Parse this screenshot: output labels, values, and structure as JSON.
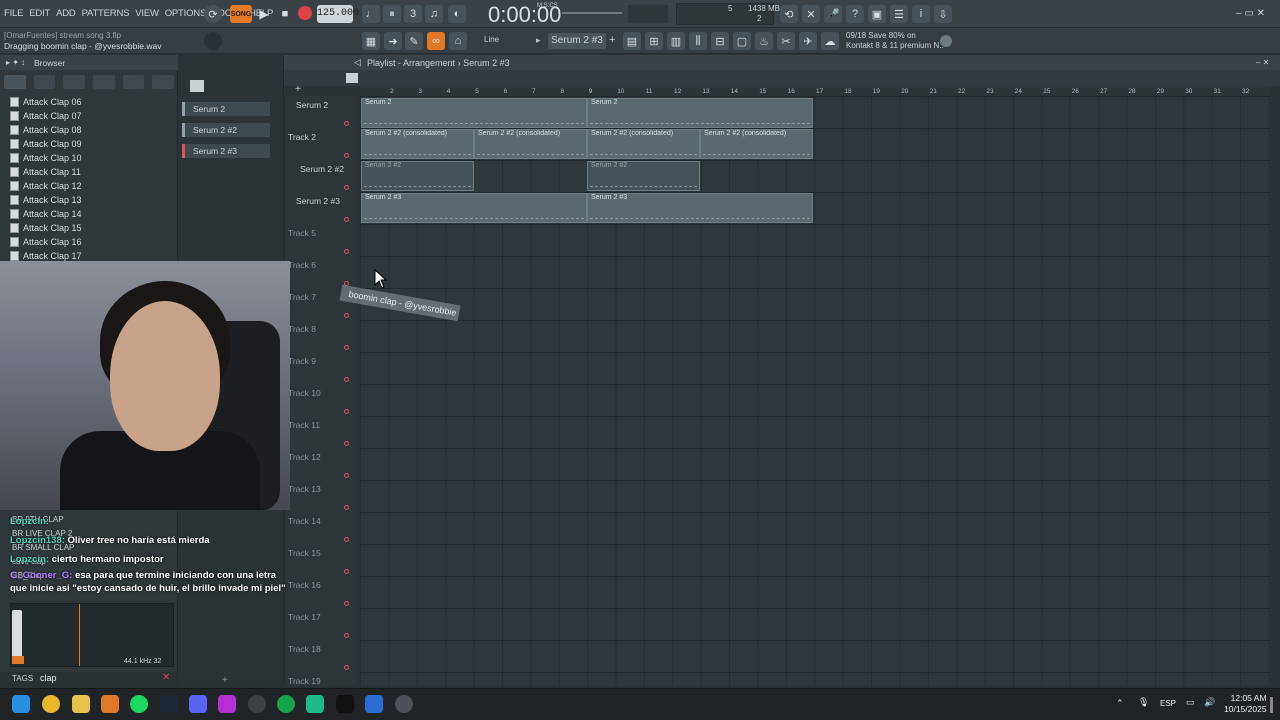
{
  "menu": [
    "FILE",
    "EDIT",
    "ADD",
    "PATTERNS",
    "VIEW",
    "OPTIONS",
    "TOOLS",
    "HELP"
  ],
  "transport": {
    "song_label": "SONG",
    "tempo": "125.000",
    "time": "0:00:00",
    "time_unit": "M:S:CS",
    "memory": "1438 MB",
    "voices": "5",
    "cpu": "2"
  },
  "status": {
    "file_info": "[OmarFuentes] stream song 3.flp",
    "hint": "Dragging boomin clap - @yvesrobbie.wav"
  },
  "toolbar2": {
    "snap": "Line",
    "pattern": "Serum 2 #3",
    "news_date": "09/18",
    "news_line1": "Save 80% on",
    "news_line2": "Kontakt 8 & 11 premium N.."
  },
  "browser": {
    "title": "Browser",
    "items": [
      "Attack Clap 06",
      "Attack Clap 07",
      "Attack Clap 08",
      "Attack Clap 09",
      "Attack Clap 10",
      "Attack Clap 11",
      "Attack Clap 12",
      "Attack Clap 13",
      "Attack Clap 14",
      "Attack Clap 15",
      "Attack Clap 16",
      "Attack Clap 17"
    ],
    "lower_items": [
      "BR 9TH CLAP",
      "BR LIVE CLAP 2",
      "BR SMALL CLAP",
      "cave clap",
      "CB_Clap"
    ],
    "sample_rate": "44.1 kHz 32",
    "tags_label": "TAGS",
    "tags_value": "clap"
  },
  "picker": {
    "items": [
      "Serum 2",
      "Serum 2 #2",
      "Serum 2 #3"
    ]
  },
  "playlist": {
    "title": "Playlist - Arrangement",
    "pattern": "Serum 2 #3",
    "ruler": [
      "2",
      "3",
      "4",
      "5",
      "6",
      "7",
      "8",
      "9",
      "10",
      "11",
      "12",
      "13",
      "14",
      "15",
      "16",
      "17",
      "18",
      "19",
      "20",
      "21",
      "22",
      "23",
      "24",
      "25",
      "26",
      "27",
      "28",
      "29",
      "30",
      "31",
      "32"
    ],
    "tracks": [
      "Serum 2",
      "Track 2",
      "Serum 2 #2",
      "Serum 2 #3",
      "Track 5",
      "Track 6",
      "Track 7",
      "Track 8",
      "Track 9",
      "Track 10",
      "Track 11",
      "Track 12",
      "Track 13",
      "Track 14",
      "Track 15",
      "Track 16",
      "Track 17",
      "Track 18",
      "Track 19"
    ],
    "clips": {
      "serum2": "Serum 2",
      "consolidated": "Serum 2 #2 (consolidated)",
      "serum2_2": "Serum 2 #2",
      "serum2_3": "Serum 2 #3"
    },
    "drag_ghost": "boomin clap - @yvesrobbie"
  },
  "chat": [
    {
      "user": "Lopzcin:",
      "text": ""
    },
    {
      "user": "Lopzcin138:",
      "text": "Oliver tree no haría está mierda"
    },
    {
      "user": "Lopzcin:",
      "text": "cierto hermano impostor"
    },
    {
      "user": "G_Gooner_G:",
      "text": "esa para que termine iniciando con una letra"
    },
    {
      "user": "",
      "text": "que inicie asi \"estoy cansado de huir, el brillo invade mi piel\""
    }
  ],
  "taskbar": {
    "lang": "ESP",
    "time": "12:05 AM",
    "date": "10/15/2025"
  }
}
